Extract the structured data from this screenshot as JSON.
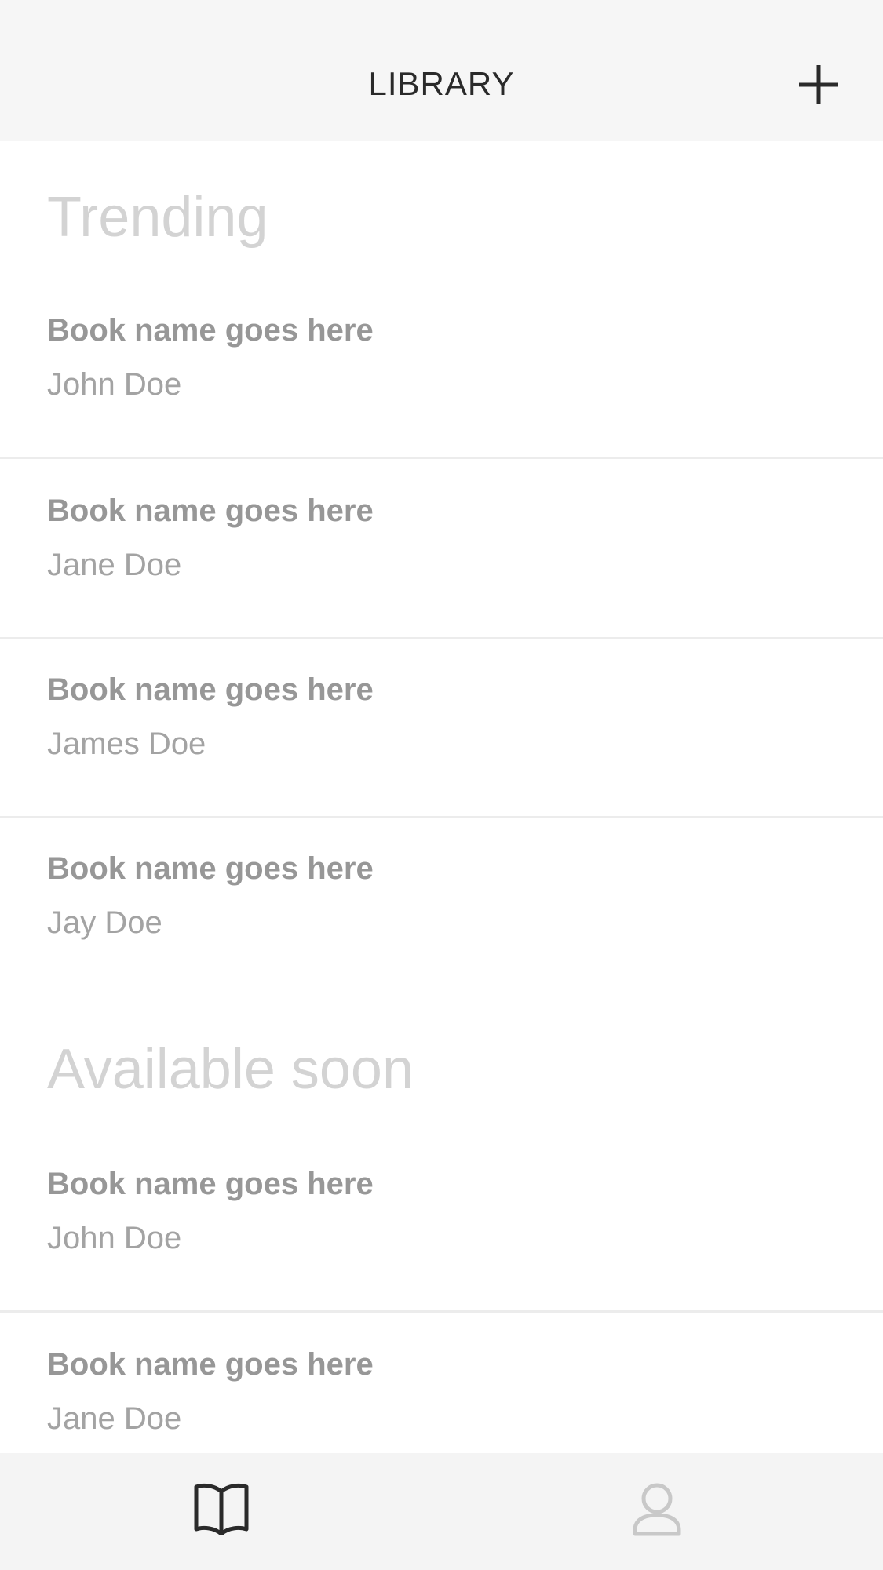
{
  "header": {
    "title": "LIBRARY",
    "add_icon": "plus-icon"
  },
  "sections": [
    {
      "heading": "Trending",
      "books": [
        {
          "title": "Book name goes here",
          "author": "John Doe"
        },
        {
          "title": "Book name goes here",
          "author": "Jane Doe"
        },
        {
          "title": "Book name goes here",
          "author": "James Doe"
        },
        {
          "title": "Book name goes here",
          "author": "Jay Doe"
        }
      ]
    },
    {
      "heading": "Available soon",
      "books": [
        {
          "title": "Book name goes here",
          "author": "John Doe"
        },
        {
          "title": "Book name goes here",
          "author": "Jane Doe"
        }
      ]
    }
  ],
  "tab_bar": {
    "tabs": [
      {
        "icon": "book-icon",
        "active": true
      },
      {
        "icon": "user-icon",
        "active": false
      }
    ]
  },
  "colors": {
    "header_bg": "#f6f6f6",
    "heading": "#d3d3d3",
    "book_title": "#979797",
    "author": "#a3a3a3",
    "divider": "#ececec",
    "icon_active": "#2a2a2a",
    "icon_inactive": "#c8c8c8"
  }
}
